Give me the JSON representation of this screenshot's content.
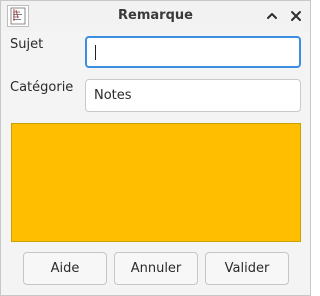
{
  "window": {
    "title": "Remarque",
    "app_icon": "notepad-icon"
  },
  "titlebar_buttons": {
    "restore_icon": "chevron-up-icon",
    "close_icon": "close-icon"
  },
  "form": {
    "subject_label": "Sujet",
    "subject_value": "",
    "category_label": "Catégorie",
    "category_value": "Notes"
  },
  "color_preview": {
    "color": "#ffbf00"
  },
  "buttons": {
    "help_label": "Aide",
    "cancel_label": "Annuler",
    "ok_label": "Valider"
  },
  "colors": {
    "focus_border": "#3d8ee0"
  }
}
